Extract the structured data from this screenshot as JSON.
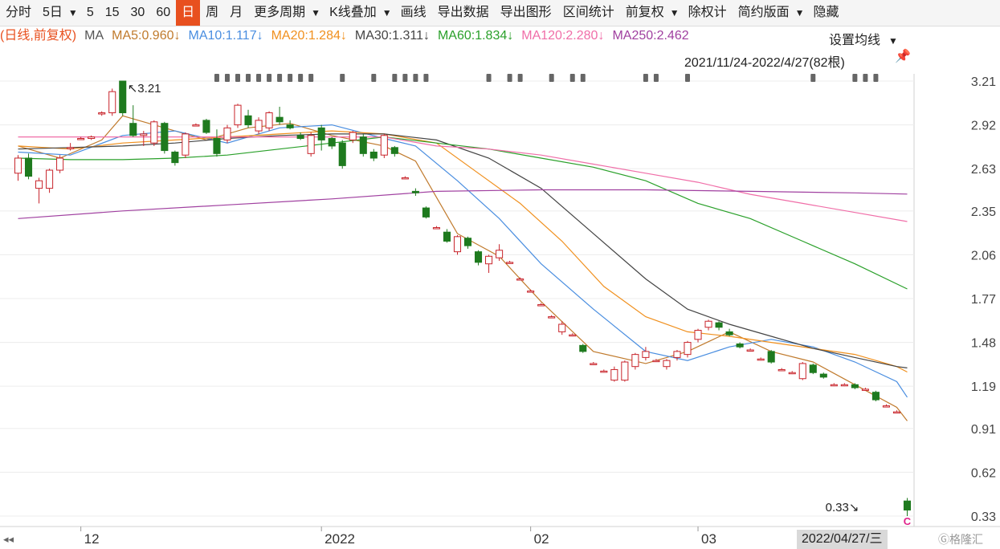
{
  "toolbar": {
    "items": [
      "分时",
      "5日",
      "▼",
      "5",
      "15",
      "30",
      "60",
      "日",
      "周",
      "月",
      "更多周期",
      "▼",
      "K线叠加",
      "▼",
      "画线",
      "导出数据",
      "导出图形",
      "区间统计",
      "前复权",
      "▼",
      "除权计",
      "简约版面",
      "▼",
      "隐藏"
    ],
    "active": "日"
  },
  "ma_legend": {
    "prefix": "(日线,前复权)",
    "ma_label": "MA",
    "items": [
      {
        "label": "MA5:0.960↓",
        "color": "#c07a2c"
      },
      {
        "label": "MA10:1.117↓",
        "color": "#4a8ee0"
      },
      {
        "label": "MA20:1.284↓",
        "color": "#f0901e"
      },
      {
        "label": "MA30:1.311↓",
        "color": "#444444"
      },
      {
        "label": "MA60:1.834↓",
        "color": "#2aa02a"
      },
      {
        "label": "MA120:2.280↓",
        "color": "#f06ea8"
      },
      {
        "label": "MA250:2.462",
        "color": "#a040a0"
      }
    ],
    "prefix_color": "#e8501f",
    "setting_label": "设置均线",
    "setting_arrow": "▼"
  },
  "range_label": "2021/11/24-2022/4/27(82根)",
  "pin_icon": "pin-icon",
  "footer_date": "2022/04/27/三",
  "logo_text": "Ⓖ格隆汇",
  "chart_data": {
    "type": "candlestick",
    "y_ticks": [
      "3.21",
      "2.92",
      "2.63",
      "2.35",
      "2.06",
      "1.77",
      "1.48",
      "1.19",
      "0.91",
      "0.62",
      "0.33"
    ],
    "ylim": [
      0.33,
      3.21
    ],
    "x_ticks": [
      {
        "label": "12",
        "index": 6
      },
      {
        "label": "2022",
        "index": 29
      },
      {
        "label": "02",
        "index": 49
      },
      {
        "label": "03",
        "index": 65
      }
    ],
    "scroll_left": "◂◂",
    "annotations": [
      {
        "text": "↖3.21",
        "index": 10,
        "value": 3.21
      },
      {
        "text": "0.33↘",
        "index": 81,
        "value": 0.33
      }
    ],
    "latest_marker": "C",
    "up_color": "#c8242b",
    "down_color": "#1e7a1e",
    "news_marker_indices": [
      19,
      20,
      21,
      22,
      23,
      24,
      25,
      26,
      27,
      28,
      31,
      34,
      36,
      37,
      38,
      39,
      45,
      47,
      48,
      51,
      53,
      54,
      60,
      61,
      64,
      76,
      80,
      81,
      82
    ],
    "candles": [
      [
        2.6,
        2.7,
        2.55,
        2.72
      ],
      [
        2.7,
        2.58,
        2.56,
        2.73
      ],
      [
        2.5,
        2.55,
        2.4,
        2.57
      ],
      [
        2.5,
        2.62,
        2.47,
        2.63
      ],
      [
        2.62,
        2.7,
        2.6,
        2.72
      ],
      [
        2.77,
        2.77,
        2.75,
        2.8
      ],
      [
        2.83,
        2.83,
        2.82,
        2.84
      ],
      [
        2.83,
        2.84,
        2.82,
        2.85
      ],
      [
        3.0,
        3.0,
        2.98,
        3.01
      ],
      [
        3.0,
        3.14,
        2.98,
        3.16
      ],
      [
        3.21,
        3.0,
        2.98,
        3.21
      ],
      [
        2.93,
        2.85,
        2.84,
        3.05
      ],
      [
        2.85,
        2.86,
        2.78,
        2.88
      ],
      [
        2.8,
        2.94,
        2.78,
        2.95
      ],
      [
        2.93,
        2.75,
        2.73,
        2.94
      ],
      [
        2.74,
        2.67,
        2.65,
        2.75
      ],
      [
        2.72,
        2.86,
        2.7,
        2.87
      ],
      [
        2.92,
        2.92,
        2.91,
        2.93
      ],
      [
        2.95,
        2.87,
        2.86,
        2.96
      ],
      [
        2.83,
        2.73,
        2.71,
        2.89
      ],
      [
        2.82,
        2.9,
        2.8,
        2.92
      ],
      [
        2.92,
        3.05,
        2.9,
        3.06
      ],
      [
        2.98,
        2.92,
        2.9,
        3.02
      ],
      [
        2.88,
        2.95,
        2.86,
        2.97
      ],
      [
        2.9,
        3.0,
        2.88,
        3.01
      ],
      [
        2.97,
        2.94,
        2.92,
        3.04
      ],
      [
        2.92,
        2.9,
        2.89,
        2.95
      ],
      [
        2.85,
        2.83,
        2.82,
        2.87
      ],
      [
        2.73,
        2.85,
        2.71,
        2.87
      ],
      [
        2.9,
        2.82,
        2.75,
        2.92
      ],
      [
        2.83,
        2.78,
        2.76,
        2.84
      ],
      [
        2.8,
        2.65,
        2.63,
        2.82
      ],
      [
        2.82,
        2.87,
        2.8,
        2.88
      ],
      [
        2.84,
        2.73,
        2.71,
        2.86
      ],
      [
        2.74,
        2.7,
        2.68,
        2.76
      ],
      [
        2.72,
        2.85,
        2.7,
        2.86
      ],
      [
        2.77,
        2.73,
        2.71,
        2.78
      ],
      [
        2.57,
        2.57,
        2.56,
        2.58
      ],
      [
        2.48,
        2.47,
        2.45,
        2.5
      ],
      [
        2.37,
        2.31,
        2.3,
        2.38
      ],
      [
        2.24,
        2.24,
        2.23,
        2.25
      ],
      [
        2.21,
        2.15,
        2.14,
        2.23
      ],
      [
        2.08,
        2.18,
        2.06,
        2.19
      ],
      [
        2.17,
        2.12,
        2.1,
        2.18
      ],
      [
        2.08,
        2.01,
        1.99,
        2.09
      ],
      [
        2.0,
        2.05,
        1.94,
        2.06
      ],
      [
        2.04,
        2.09,
        2.02,
        2.13
      ],
      [
        2.01,
        2.01,
        2.0,
        2.02
      ],
      [
        1.9,
        1.9,
        1.89,
        1.91
      ],
      [
        1.82,
        1.82,
        1.81,
        1.83
      ],
      [
        1.73,
        1.73,
        1.72,
        1.74
      ],
      [
        1.65,
        1.65,
        1.64,
        1.66
      ],
      [
        1.55,
        1.6,
        1.53,
        1.62
      ],
      [
        1.53,
        1.53,
        1.52,
        1.54
      ],
      [
        1.46,
        1.42,
        1.41,
        1.47
      ],
      [
        1.34,
        1.34,
        1.33,
        1.35
      ],
      [
        1.29,
        1.29,
        1.28,
        1.3
      ],
      [
        1.23,
        1.3,
        1.22,
        1.32
      ],
      [
        1.23,
        1.35,
        1.22,
        1.36
      ],
      [
        1.32,
        1.4,
        1.3,
        1.41
      ],
      [
        1.38,
        1.42,
        1.36,
        1.45
      ],
      [
        1.36,
        1.36,
        1.35,
        1.37
      ],
      [
        1.32,
        1.36,
        1.3,
        1.37
      ],
      [
        1.38,
        1.42,
        1.36,
        1.43
      ],
      [
        1.4,
        1.48,
        1.38,
        1.49
      ],
      [
        1.5,
        1.56,
        1.48,
        1.57
      ],
      [
        1.58,
        1.62,
        1.56,
        1.63
      ],
      [
        1.61,
        1.58,
        1.56,
        1.62
      ],
      [
        1.55,
        1.53,
        1.52,
        1.57
      ],
      [
        1.47,
        1.45,
        1.44,
        1.48
      ],
      [
        1.43,
        1.43,
        1.42,
        1.44
      ],
      [
        1.37,
        1.37,
        1.36,
        1.38
      ],
      [
        1.42,
        1.35,
        1.34,
        1.43
      ],
      [
        1.3,
        1.3,
        1.29,
        1.31
      ],
      [
        1.28,
        1.28,
        1.27,
        1.29
      ],
      [
        1.24,
        1.34,
        1.23,
        1.35
      ],
      [
        1.33,
        1.28,
        1.27,
        1.34
      ],
      [
        1.27,
        1.25,
        1.24,
        1.28
      ],
      [
        1.2,
        1.2,
        1.19,
        1.21
      ],
      [
        1.2,
        1.2,
        1.19,
        1.21
      ],
      [
        1.2,
        1.18,
        1.17,
        1.21
      ],
      [
        1.17,
        1.17,
        1.16,
        1.18
      ],
      [
        1.15,
        1.1,
        1.09,
        1.16
      ],
      [
        1.06,
        1.06,
        1.05,
        1.07
      ],
      [
        1.02,
        1.02,
        1.01,
        1.03
      ],
      [
        0.43,
        0.37,
        0.33,
        0.45
      ]
    ],
    "ma_lines": [
      {
        "name": "MA5",
        "color": "#c07a2c",
        "points": [
          [
            0,
            2.78
          ],
          [
            4,
            2.7
          ],
          [
            8,
            2.82
          ],
          [
            10,
            2.98
          ],
          [
            14,
            2.9
          ],
          [
            18,
            2.82
          ],
          [
            22,
            2.9
          ],
          [
            26,
            2.93
          ],
          [
            30,
            2.85
          ],
          [
            35,
            2.78
          ],
          [
            38,
            2.68
          ],
          [
            42,
            2.2
          ],
          [
            46,
            2.05
          ],
          [
            50,
            1.75
          ],
          [
            55,
            1.42
          ],
          [
            60,
            1.34
          ],
          [
            64,
            1.42
          ],
          [
            68,
            1.55
          ],
          [
            72,
            1.42
          ],
          [
            76,
            1.35
          ],
          [
            80,
            1.2
          ],
          [
            84,
            1.05
          ],
          [
            85,
            0.96
          ]
        ]
      },
      {
        "name": "MA10",
        "color": "#4a8ee0",
        "points": [
          [
            0,
            2.74
          ],
          [
            5,
            2.72
          ],
          [
            10,
            2.85
          ],
          [
            15,
            2.88
          ],
          [
            20,
            2.8
          ],
          [
            25,
            2.9
          ],
          [
            30,
            2.92
          ],
          [
            35,
            2.83
          ],
          [
            38,
            2.78
          ],
          [
            42,
            2.55
          ],
          [
            46,
            2.3
          ],
          [
            50,
            2.0
          ],
          [
            55,
            1.7
          ],
          [
            60,
            1.42
          ],
          [
            64,
            1.36
          ],
          [
            68,
            1.45
          ],
          [
            72,
            1.5
          ],
          [
            76,
            1.45
          ],
          [
            80,
            1.35
          ],
          [
            84,
            1.22
          ],
          [
            85,
            1.117
          ]
        ]
      },
      {
        "name": "MA20",
        "color": "#f0901e",
        "points": [
          [
            0,
            2.78
          ],
          [
            5,
            2.76
          ],
          [
            10,
            2.8
          ],
          [
            15,
            2.82
          ],
          [
            20,
            2.84
          ],
          [
            25,
            2.86
          ],
          [
            30,
            2.88
          ],
          [
            35,
            2.86
          ],
          [
            40,
            2.8
          ],
          [
            44,
            2.6
          ],
          [
            48,
            2.4
          ],
          [
            52,
            2.15
          ],
          [
            56,
            1.85
          ],
          [
            60,
            1.65
          ],
          [
            64,
            1.55
          ],
          [
            68,
            1.52
          ],
          [
            72,
            1.48
          ],
          [
            76,
            1.44
          ],
          [
            80,
            1.4
          ],
          [
            84,
            1.32
          ],
          [
            85,
            1.284
          ]
        ]
      },
      {
        "name": "MA30",
        "color": "#444444",
        "points": [
          [
            0,
            2.76
          ],
          [
            5,
            2.77
          ],
          [
            10,
            2.78
          ],
          [
            15,
            2.8
          ],
          [
            20,
            2.83
          ],
          [
            25,
            2.85
          ],
          [
            30,
            2.86
          ],
          [
            35,
            2.86
          ],
          [
            40,
            2.82
          ],
          [
            45,
            2.7
          ],
          [
            50,
            2.5
          ],
          [
            55,
            2.2
          ],
          [
            60,
            1.9
          ],
          [
            64,
            1.7
          ],
          [
            68,
            1.6
          ],
          [
            72,
            1.52
          ],
          [
            76,
            1.44
          ],
          [
            80,
            1.38
          ],
          [
            84,
            1.32
          ],
          [
            85,
            1.311
          ]
        ]
      },
      {
        "name": "MA60",
        "color": "#2aa02a",
        "points": [
          [
            0,
            2.7
          ],
          [
            5,
            2.69
          ],
          [
            10,
            2.69
          ],
          [
            15,
            2.7
          ],
          [
            20,
            2.72
          ],
          [
            25,
            2.76
          ],
          [
            30,
            2.8
          ],
          [
            35,
            2.84
          ],
          [
            40,
            2.8
          ],
          [
            45,
            2.76
          ],
          [
            50,
            2.7
          ],
          [
            55,
            2.64
          ],
          [
            60,
            2.55
          ],
          [
            65,
            2.4
          ],
          [
            70,
            2.3
          ],
          [
            75,
            2.15
          ],
          [
            80,
            2.0
          ],
          [
            85,
            1.834
          ]
        ]
      },
      {
        "name": "MA120",
        "color": "#f06ea8",
        "points": [
          [
            0,
            2.84
          ],
          [
            10,
            2.84
          ],
          [
            20,
            2.84
          ],
          [
            30,
            2.84
          ],
          [
            35,
            2.84
          ],
          [
            40,
            2.78
          ],
          [
            45,
            2.76
          ],
          [
            50,
            2.72
          ],
          [
            55,
            2.66
          ],
          [
            60,
            2.6
          ],
          [
            65,
            2.54
          ],
          [
            70,
            2.46
          ],
          [
            75,
            2.4
          ],
          [
            80,
            2.34
          ],
          [
            85,
            2.28
          ]
        ]
      },
      {
        "name": "MA250",
        "color": "#a040a0",
        "points": [
          [
            0,
            2.3
          ],
          [
            10,
            2.35
          ],
          [
            20,
            2.39
          ],
          [
            30,
            2.43
          ],
          [
            40,
            2.48
          ],
          [
            50,
            2.49
          ],
          [
            60,
            2.49
          ],
          [
            70,
            2.48
          ],
          [
            80,
            2.47
          ],
          [
            85,
            2.462
          ]
        ]
      }
    ]
  }
}
